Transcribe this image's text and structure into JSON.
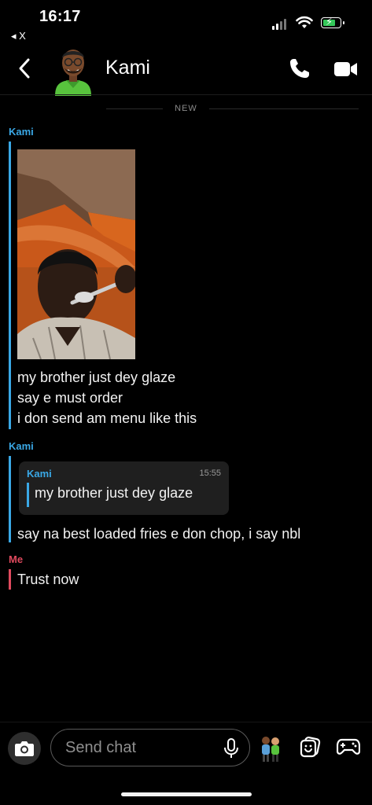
{
  "status_bar": {
    "time": "16:17",
    "back_app": "◂ X",
    "battery_color": "#34c759"
  },
  "header": {
    "contact_name": "Kami",
    "back_icon": "chevron-left-icon",
    "call_icon": "phone-icon",
    "video_icon": "video-camera-icon"
  },
  "divider": {
    "label": "NEW"
  },
  "messages": [
    {
      "sender": "Kami",
      "has_photo": true,
      "lines": [
        "my brother just dey glaze",
        "say e must order",
        "i don send am menu like this"
      ]
    },
    {
      "sender": "Kami",
      "quote": {
        "sender": "Kami",
        "time": "15:55",
        "text": "my brother just dey glaze"
      },
      "lines": [
        "say na best loaded fries e don chop, i say nbl"
      ]
    },
    {
      "sender": "Me",
      "lines": [
        "Trust now"
      ]
    }
  ],
  "composer": {
    "placeholder": "Send chat",
    "camera_icon": "camera-icon",
    "mic_icon": "microphone-icon",
    "bitmoji_icon": "bitmoji-icon",
    "sticker_icon": "sticker-icon",
    "games_icon": "game-controller-icon"
  },
  "colors": {
    "kami_accent": "#3aa8e6",
    "me_accent": "#e04a5e",
    "background": "#000000"
  }
}
